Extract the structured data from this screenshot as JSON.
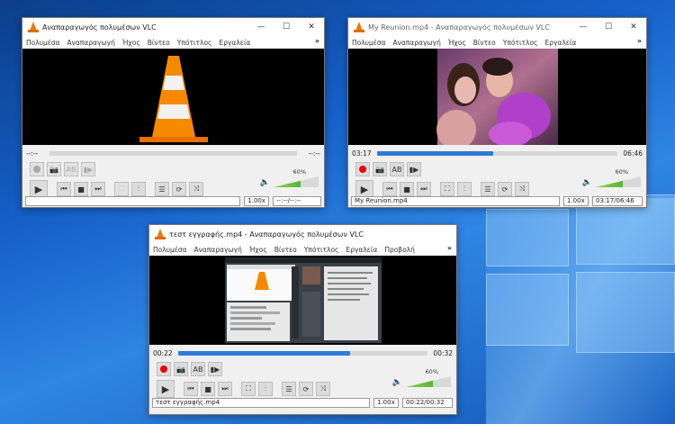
{
  "desktop": {
    "accent": "#1560c9"
  },
  "windows": [
    {
      "title": "Αναπαραγωγός πολυμέσων VLC",
      "menu": [
        "Πολυμέσα",
        "Αναπαραγωγή",
        "Ήχος",
        "Βίντεο",
        "Υπότιτλος",
        "Εργαλεία"
      ],
      "more": "»",
      "time_left": "--:--",
      "time_right": "--:--",
      "progress": 0,
      "volume": "60%",
      "status_name": "",
      "speed": "1.00x",
      "status_time": "--:--/--:--",
      "video": "vlc-cone"
    },
    {
      "title": "My Reunion.mp4 - Αναπαραγωγός πολυμέσων VLC",
      "menu": [
        "Πολυμέσα",
        "Αναπαραγωγή",
        "Ήχος",
        "Βίντεο",
        "Υπότιτλος",
        "Εργαλεία"
      ],
      "more": "»",
      "time_left": "03:17",
      "time_right": "06:46",
      "progress": 0.485,
      "volume": "60%",
      "status_name": "My Reunion.mp4",
      "speed": "1.00x",
      "status_time": "03:17/06:46",
      "video": "party-photo"
    },
    {
      "title": "τεστ εγγραφής.mp4 - Αναπαραγωγός πολυμέσων VLC",
      "menu": [
        "Πολυμέσα",
        "Αναπαραγωγή",
        "Ήχος",
        "Βίντεο",
        "Υπότιτλος",
        "Εργαλεία",
        "Προβολή"
      ],
      "more": "»",
      "time_left": "00:22",
      "time_right": "00:32",
      "progress": 0.69,
      "volume": "60%",
      "status_name": "τεστ εγγραφής.mp4",
      "speed": "1.00x",
      "status_time": "00:22/00:32",
      "video": "screen-recording"
    }
  ],
  "icons": {
    "minimize": "—",
    "maximize": "☐",
    "close": "✕",
    "snapshot": "📷",
    "loop_ab": "AB",
    "frame": "▮▶",
    "play": "▶",
    "prev": "⏮",
    "stop": "■",
    "next": "⏭",
    "fullscreen": "⛶",
    "extended": "⫶",
    "playlist": "☰",
    "loop": "⟳",
    "shuffle": "⤨",
    "speaker": "🔈"
  }
}
